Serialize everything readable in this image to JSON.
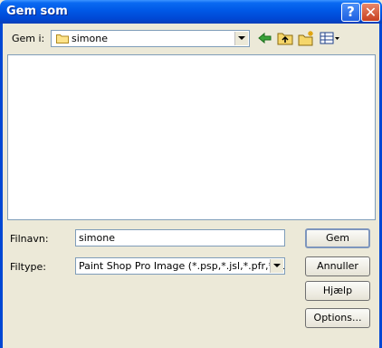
{
  "window": {
    "title": "Gem som"
  },
  "titlebar": {
    "help_glyph": "?",
    "close_glyph": "✕"
  },
  "lookin": {
    "label": "Gem i:",
    "value": "simone",
    "icon": "folder-icon"
  },
  "toolbar": {
    "icons": [
      "back-arrow-icon",
      "up-folder-icon",
      "new-folder-icon",
      "view-menu-icon"
    ]
  },
  "filename": {
    "label": "Filnavn:",
    "value": "simone"
  },
  "filetype": {
    "label": "Filtype:",
    "value": "Paint Shop Pro Image (*.psp,*.jsl,*.pfr,*.tub)"
  },
  "buttons": {
    "save": "Gem",
    "cancel": "Annuller",
    "help": "Hjælp",
    "options": "Options..."
  },
  "colors": {
    "titlebar": "#0058e6",
    "dialog_bg": "#ece9d8",
    "close": "#c8401f"
  }
}
